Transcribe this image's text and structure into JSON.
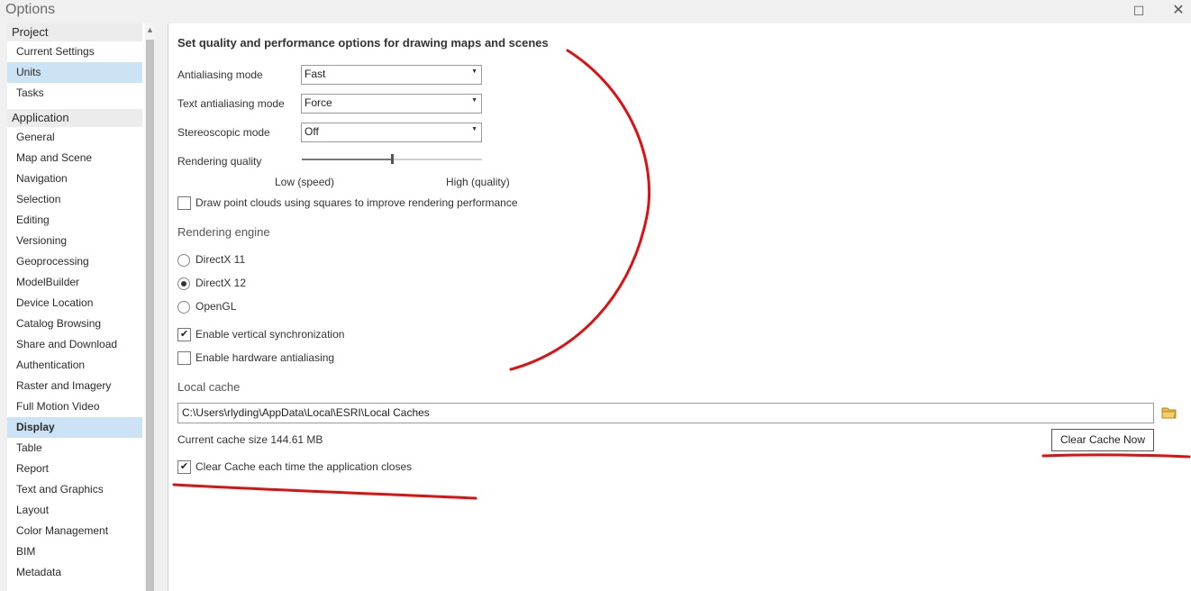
{
  "window": {
    "title": "Options",
    "maximize_icon": "maximize-icon",
    "close_icon": "close-icon"
  },
  "sidebar": {
    "groups": [
      {
        "header": "Project",
        "items": [
          "Current Settings",
          "Units",
          "Tasks"
        ]
      },
      {
        "header": "Application",
        "items": [
          "General",
          "Map and Scene",
          "Navigation",
          "Selection",
          "Editing",
          "Versioning",
          "Geoprocessing",
          "ModelBuilder",
          "Device Location",
          "Catalog Browsing",
          "Share and Download",
          "Authentication",
          "Raster and Imagery",
          "Full Motion Video",
          "Display",
          "Table",
          "Report",
          "Text and Graphics",
          "Layout",
          "Color Management",
          "BIM",
          "Metadata"
        ]
      }
    ],
    "selected": [
      "Units",
      "Display"
    ]
  },
  "display": {
    "heading": "Set quality and performance options for drawing maps and scenes",
    "antialiasing_label": "Antialiasing mode",
    "antialiasing_value": "Fast",
    "text_antialiasing_label": "Text antialiasing mode",
    "text_antialiasing_value": "Force",
    "stereo_label": "Stereoscopic mode",
    "stereo_value": "Off",
    "quality_label": "Rendering quality",
    "quality_low": "Low (speed)",
    "quality_high": "High (quality)",
    "quality_level": 0.5,
    "point_clouds_label": "Draw point clouds using squares to improve rendering performance",
    "point_clouds_checked": false,
    "engine_heading": "Rendering engine",
    "engines": [
      "DirectX 11",
      "DirectX 12",
      "OpenGL"
    ],
    "engine_selected": "DirectX 12",
    "vsync_label": "Enable vertical synchronization",
    "vsync_checked": true,
    "hw_aa_label": "Enable hardware antialiasing",
    "hw_aa_checked": false,
    "cache_heading": "Local cache",
    "cache_path": "C:\\Users\\rlyding\\AppData\\Local\\ESRI\\Local Caches",
    "cache_size": "Current cache size 144.61 MB",
    "clear_button": "Clear Cache Now",
    "clear_on_close_label": "Clear Cache each time the application closes",
    "clear_on_close_checked": true
  },
  "colors": {
    "annotation": "#dd1111",
    "selection": "#cce3f5"
  }
}
